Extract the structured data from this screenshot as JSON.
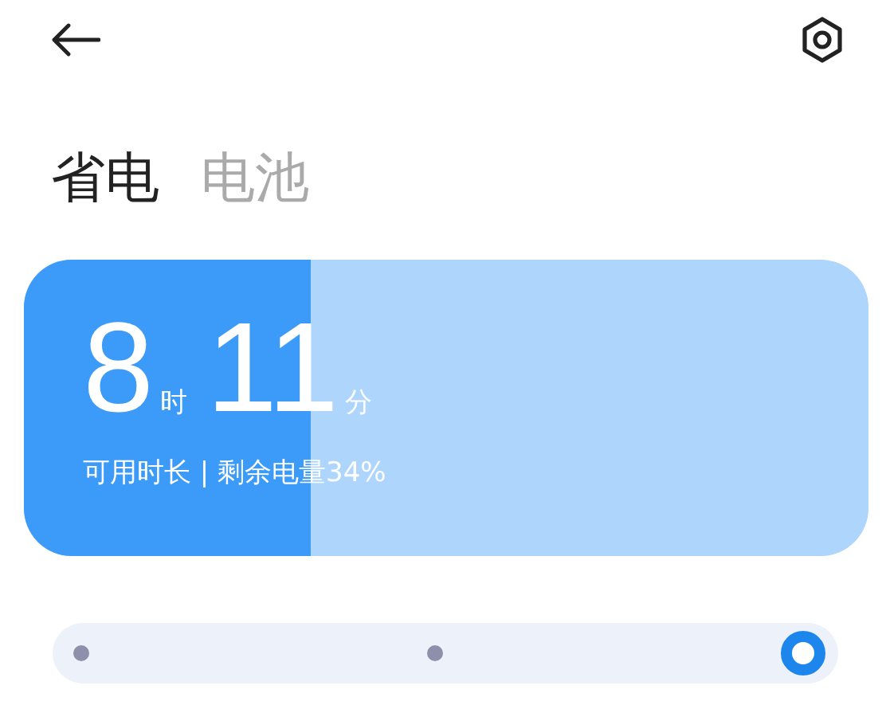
{
  "tabs": [
    {
      "label": "省电",
      "selected": true
    },
    {
      "label": "电池",
      "selected": false
    }
  ],
  "battery": {
    "level": 0.34,
    "hours": "8",
    "hours_unit": "时",
    "minutes": "11",
    "minutes_unit": "分",
    "caption": "可用时长 | 剩余电量34%"
  },
  "modes": [
    {
      "selected": false
    },
    {
      "selected": false
    },
    {
      "selected": true
    }
  ]
}
